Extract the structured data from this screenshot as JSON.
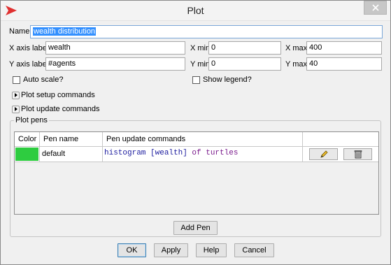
{
  "window": {
    "title": "Plot"
  },
  "form": {
    "name_label": "Name",
    "name_value": "wealth distribution",
    "x_axis_label": "X axis label",
    "x_axis_value": "wealth",
    "y_axis_label": "Y axis label",
    "y_axis_value": "#agents",
    "x_min_label": "X min",
    "x_min_value": "0",
    "x_max_label": "X max",
    "x_max_value": "400",
    "y_min_label": "Y min",
    "y_min_value": "0",
    "y_max_label": "Y max",
    "y_max_value": "40",
    "auto_scale_label": "Auto scale?",
    "auto_scale_checked": false,
    "show_legend_label": "Show legend?",
    "show_legend_checked": false,
    "setup_commands_label": "Plot setup commands",
    "update_commands_label": "Plot update commands"
  },
  "pens": {
    "group_title": "Plot pens",
    "columns": [
      "Color",
      "Pen name",
      "Pen update commands"
    ],
    "rows": [
      {
        "color": "#2ecc40",
        "name": "default",
        "cmd_part1": "histogram [wealth]",
        "cmd_part2": " of turtles",
        "cmd_color1": "#1a1a9e",
        "cmd_color2": "#7a1a8c"
      }
    ],
    "add_pen_label": "Add Pen",
    "edit_icon": "pencil-icon",
    "delete_icon": "trash-icon"
  },
  "buttons": {
    "ok": "OK",
    "apply": "Apply",
    "help": "Help",
    "cancel": "Cancel"
  },
  "colors": {
    "selection": "#3390ff",
    "app_icon": "#e03030"
  }
}
